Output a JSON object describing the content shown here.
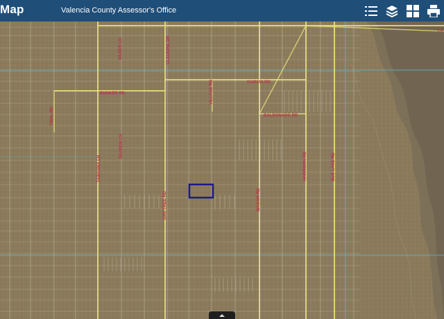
{
  "header": {
    "app_title": "Map",
    "subtitle": "Valencia County Assessor's Office"
  },
  "toolbar": {
    "icons": [
      "list-icon",
      "layers-icon",
      "basemap-gallery-icon",
      "print-icon"
    ]
  },
  "map": {
    "road_labels": [
      {
        "text": "BUNKER RD"
      },
      {
        "text": "TWAL RD"
      },
      {
        "text": "GARCIA RD"
      },
      {
        "text": "BALDONADO RD"
      },
      {
        "text": "EILEEN LN"
      },
      {
        "text": "CLAUDINE DR"
      },
      {
        "text": "SHARON LN"
      },
      {
        "text": "TAWANNA LN"
      },
      {
        "text": "OAK TREE RD"
      },
      {
        "text": "WAGON RD"
      },
      {
        "text": "HARRISON RD"
      },
      {
        "text": "BUS LAKE RD"
      },
      {
        "text": "LA"
      },
      {
        "text": "VILLAGE RD"
      }
    ],
    "colors": {
      "terrain": "#8b7a5b",
      "road": "#e9e27a",
      "parcel_line": "#d9d2c4",
      "boundary_line": "#5fb7c9",
      "selected_parcel": "#1c1a8c"
    }
  }
}
